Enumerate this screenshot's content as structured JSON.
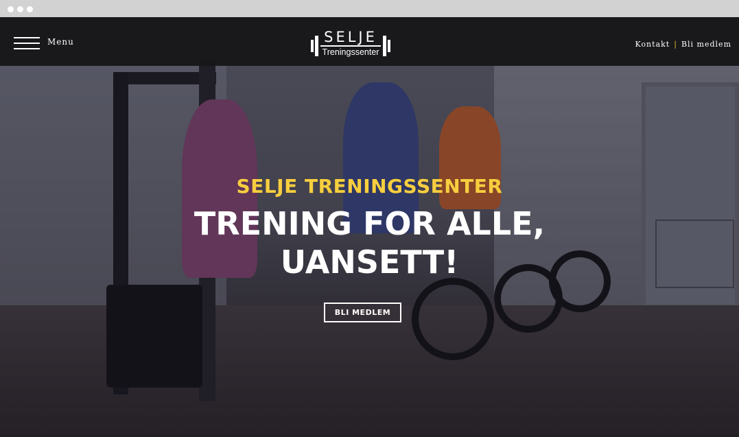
{
  "navbar": {
    "menu_label": "Menu",
    "logo_word": "SELJE",
    "logo_sub": "Treningssenter",
    "links": [
      "Kontakt",
      "Bli medlem"
    ],
    "separator": "|",
    "separator_color": "#f2c230"
  },
  "hero": {
    "kicker": "SELJE TRENINGSSENTER",
    "headline_line1": "TRENING FOR ALLE,",
    "headline_line2": "UANSETT!",
    "cta_label": "BLI MEDLEM",
    "kicker_color": "#f7ce3e"
  }
}
